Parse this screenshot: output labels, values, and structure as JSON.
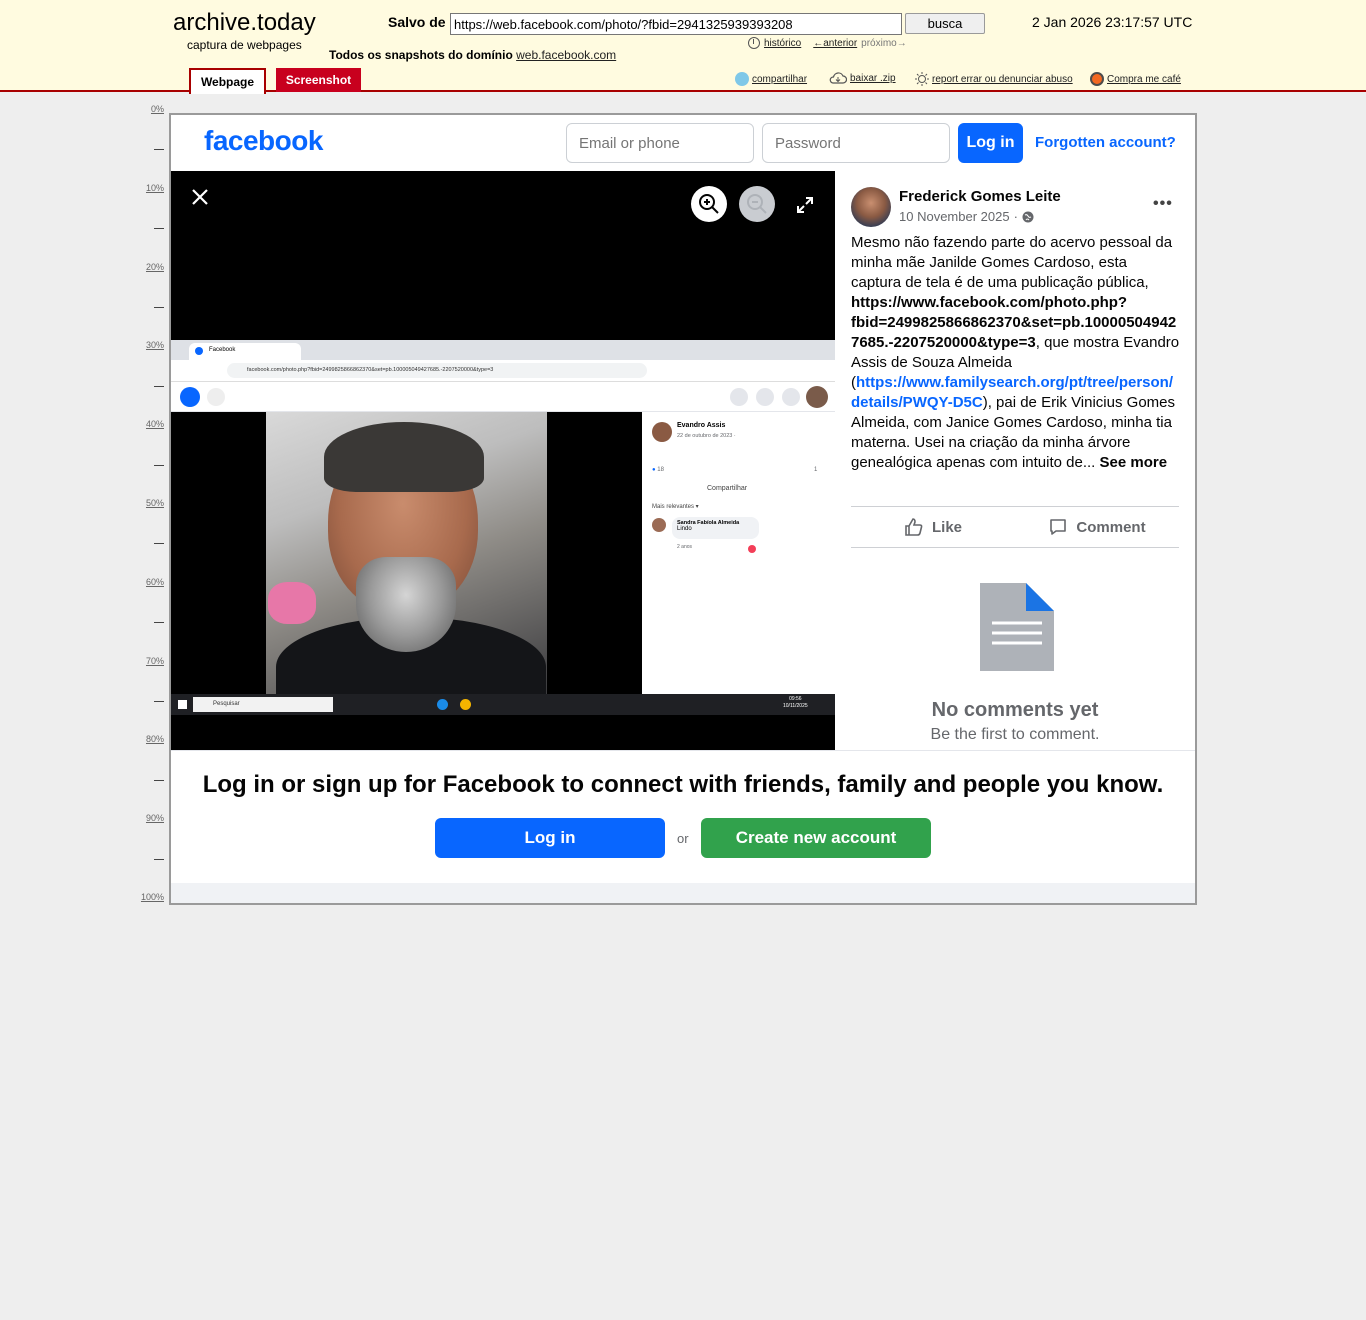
{
  "archive": {
    "logo": "archive.today",
    "tagline": "captura de webpages",
    "saved_label": "Salvo de",
    "url_value": "https://web.facebook.com/photo/?fbid=2941325939393208",
    "search_label": "busca",
    "snapshot_date": "2 Jan 2026 23:17:57 UTC",
    "history_label": "histórico",
    "prev_label": "←anterior",
    "next_label": "próximo→",
    "domain_prefix": "Todos os snapshots  do domínio",
    "domain_link": "web.facebook.com",
    "tabs": {
      "webpage": "Webpage",
      "screenshot": "Screenshot"
    },
    "tools": {
      "share": "compartilhar",
      "download": "baixar .zip",
      "report": "report errar ou denunciar abuso",
      "coffee": "Compra me café"
    },
    "accent_color": "#a80000"
  },
  "ruler": [
    "0%",
    "10%",
    "20%",
    "30%",
    "40%",
    "50%",
    "60%",
    "70%",
    "80%",
    "90%",
    "100%"
  ],
  "facebook": {
    "logo": "facebook",
    "brand_color": "#0866ff",
    "email_placeholder": "Email or phone",
    "password_placeholder": "Password",
    "login_label": "Log in",
    "forgot_label": "Forgotten account?",
    "inner_screenshot": {
      "tab_title": "Facebook",
      "url": "facebook.com/photo.php?fbid=2499825866862370&set=pb.100005049427685.-2207520000&type=3",
      "side_author": "Evandro Assis",
      "side_date": "22 de outubro de 2023 · ",
      "reactions": "18",
      "comments_count": "1",
      "share": "Compartilhar",
      "relevance": "Mais relevantes ▾",
      "commenter": "Sandra Fabíola Almeida",
      "comment_text": "Lindo",
      "comment_age": "2 anos",
      "taskbar_search": "Pesquisar",
      "clock_time": "09:56",
      "clock_date": "10/11/2025"
    },
    "post": {
      "author": "Frederick Gomes Leite",
      "date": "10 November 2025",
      "menu": "•••",
      "text_part1": "Mesmo não fazendo parte do acervo pessoal da minha mãe Janilde Gomes Cardoso, esta captura de tela é de uma publicação pública, ",
      "text_bold_url": "https://www.facebook.com/photo.php?fbid=2499825866862370&set=pb.100005049427685.-2207520000&type=3",
      "text_part2": ", que mostra Evandro Assis de Souza Almeida (",
      "text_link": "https://www.familysearch.org/pt/tree/person/details/PWQY-D5C",
      "text_part3": "), pai de Erik Vinicius Gomes Almeida, com Janice Gomes Cardoso, minha tia materna. Usei na criação da minha árvore genealógica apenas com intuito de... ",
      "see_more": "See more",
      "like": "Like",
      "comment": "Comment",
      "no_comments": "No comments yet",
      "first_comment": "Be the first to comment."
    },
    "banner": {
      "text": "Log in or sign up for Facebook to connect with friends, family and people you know.",
      "login": "Log in",
      "or": "or",
      "create": "Create new account",
      "create_color": "#31a24c"
    }
  }
}
